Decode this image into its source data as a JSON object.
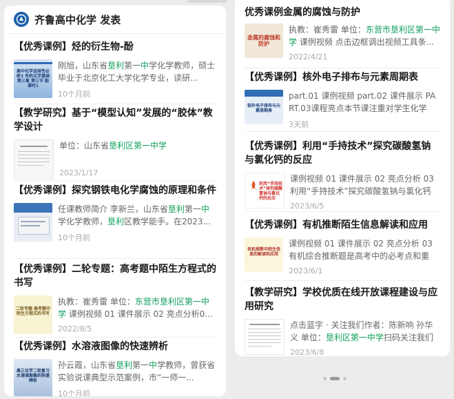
{
  "header": {
    "title": "齐鲁高中化学 发表"
  },
  "left_cards": [
    {
      "title": "【优秀课例】烃的衍生物-酚",
      "desc_parts": [
        {
          "t": "刚旭，山东省"
        },
        {
          "t": "垦利",
          "hl": true
        },
        {
          "t": "第一"
        },
        {
          "t": "中",
          "hl": true
        },
        {
          "t": "学化学教师，硕士毕业于北京化工大学化学专业，读研..."
        }
      ],
      "time": "10个月前",
      "thumb_text": "高中化学选择性必修3 有机化学基础 第三章 第三节 酚 课时1"
    },
    {
      "title": "【教学研究】基于“模型认知”发展的“胶体”教学设计",
      "desc_parts": [
        {
          "t": "单位：山东省"
        },
        {
          "t": "垦利区第一中学",
          "hl": true
        }
      ],
      "time": "2023/1/17",
      "thumb_text": ""
    },
    {
      "title": "【优秀课例】探究钢铁电化学腐蚀的原理和条件",
      "desc_parts": [
        {
          "t": "任课教师简介 李新兰，山东省"
        },
        {
          "t": "垦利",
          "hl": true
        },
        {
          "t": "第一"
        },
        {
          "t": "中",
          "hl": true
        },
        {
          "t": "学化学教师，"
        },
        {
          "t": "垦利",
          "hl": true
        },
        {
          "t": "区教学能手。在2023..."
        }
      ],
      "time": "10个月前",
      "thumb_text": ""
    },
    {
      "title": "【优秀课例】二轮专题：高考题中陌生方程式的书写",
      "desc_parts": [
        {
          "t": "执教：崔秀雷 单位："
        },
        {
          "t": "东营市垦利区第一中学",
          "hl": true
        },
        {
          "t": " 课例视频 01 课件展示 02 亮点分析0..."
        }
      ],
      "time": "2022/8/5",
      "thumb_text": "二轮专题 高考题中陌生方程式的书写"
    },
    {
      "title": "【优秀课例】水溶液图像的快速辨析",
      "desc_parts": [
        {
          "t": "孙云霞，山东省"
        },
        {
          "t": "垦利",
          "hl": true
        },
        {
          "t": "第一"
        },
        {
          "t": "中",
          "hl": true
        },
        {
          "t": "学教师，曾获省实验说课典型示范案例，市“一师一..."
        }
      ],
      "time": "10个月前",
      "thumb_text": "高三化学二轮复习 水溶液图像的快速辨析"
    }
  ],
  "right_cards": [
    {
      "title": "优秀课例金属的腐蚀与防护",
      "desc_parts": [
        {
          "t": "执教：崔秀雷 单位："
        },
        {
          "t": "东营市垦利区第一中学",
          "hl": true
        },
        {
          "t": " 课例视频 点击边框调出视频工具条..."
        }
      ],
      "time": "2022/4/21",
      "thumb_text": "金属的腐蚀和防护"
    },
    {
      "title": "【优秀课例】核外电子排布与元素周期表",
      "desc_parts": [
        {
          "t": "part.01 课例视频 part.02 课件展示 PART.03课程亮点本节课注重对学生化学学..."
        }
      ],
      "time": "3天前",
      "thumb_text": "核外电子排布与元素周期表"
    },
    {
      "title": "【优秀课例】利用“手持技术”探究碳酸氢钠与氯化钙的反应",
      "desc_parts": [
        {
          "t": "课例视频 01 课件展示 02 亮点分析 03 利用“手持技术”探究碳酸氢钠与氯化钙的..."
        }
      ],
      "time": "2023/6/5",
      "thumb_text": "利用“手持技术”探究碳酸氢钠与氯化钙的反应"
    },
    {
      "title": "【优秀课例】有机推断陌生信息解读和应用",
      "desc_parts": [
        {
          "t": "课例视频 01 课件展示 02 亮点分析 03 有机综合推断题是高考中的必考点和重点..."
        }
      ],
      "time": "2023/6/1",
      "thumb_text": "有机推断中陌生信息的解读和应用"
    },
    {
      "title": "【教学研究】学校优质在线开放课程建设与应用研究",
      "desc_parts": [
        {
          "t": "点击蓝字 · 关注我们作者：陈新响 孙华义 单位："
        },
        {
          "t": "垦利区第一中学",
          "hl": true
        },
        {
          "t": "扫码关注我们收..."
        }
      ],
      "time": "2023/6/8",
      "thumb_text": ""
    }
  ],
  "colors": {
    "highlight": "#12a05c",
    "title": "#1a1a1a",
    "desc": "#666666",
    "time": "#aaaaaa"
  }
}
